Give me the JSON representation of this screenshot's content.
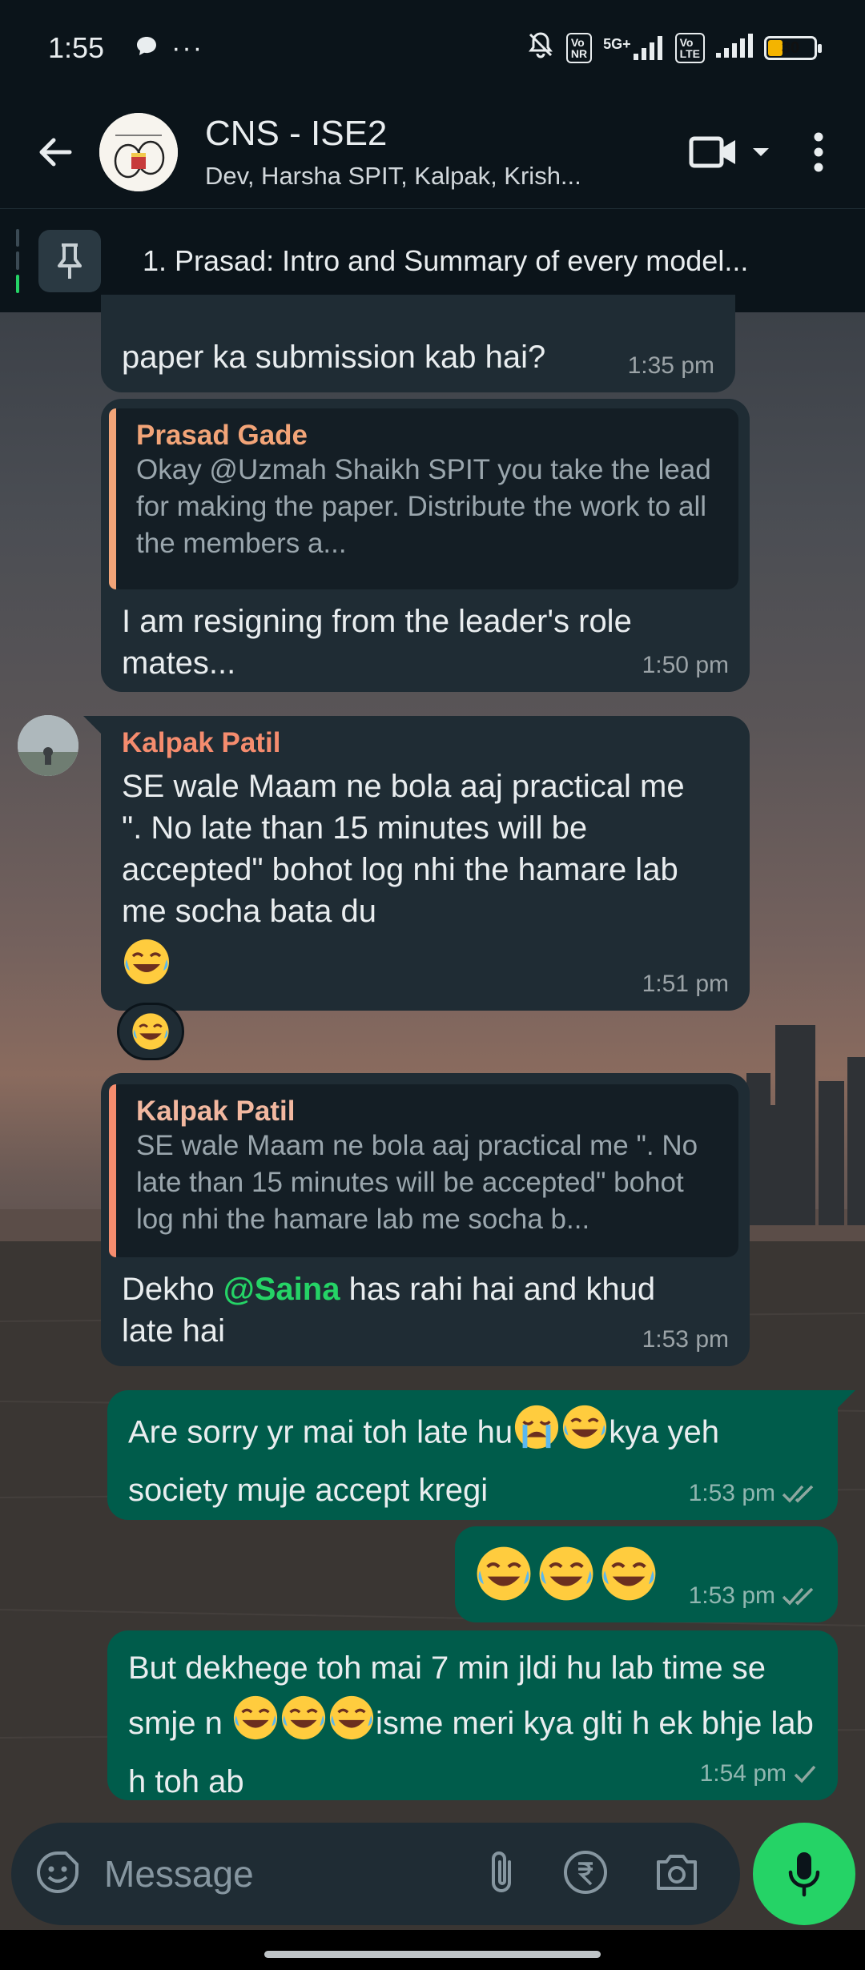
{
  "status_bar": {
    "time": "1:55",
    "network_tag": "5G+",
    "battery": "30"
  },
  "header": {
    "title": "CNS - ISE2",
    "subtitle": "Dev, Harsha SPIT, Kalpak, Krish..."
  },
  "pinned": {
    "text": "1. Prasad: Intro and Summary of every model..."
  },
  "messages": [
    {
      "text": "paper ka submission kab hai?",
      "time": "1:35 pm"
    },
    {
      "quote_name": "Prasad Gade",
      "quote_text": "Okay @Uzmah Shaikh SPIT you take the lead for making the paper. Distribute the work to all the members a...",
      "text": "I am resigning from the leader's role mates...",
      "time": "1:50 pm"
    },
    {
      "sender": "Kalpak Patil",
      "text": "SE wale Maam ne bola aaj practical me \". No late than 15 minutes will be accepted\" bohot log nhi the hamare lab me socha bata du",
      "time": "1:51 pm"
    },
    {
      "quote_name": "Kalpak Patil",
      "quote_text": "SE wale Maam ne bola aaj practical me \". No late than 15 minutes will be accepted\" bohot log nhi the hamare lab me socha b...",
      "text_before": "Dekho ",
      "mention": "@Saina",
      "text_after": " has rahi hai and khud late hai",
      "time": "1:53 pm"
    },
    {
      "text_a": "Are sorry yr mai toh late hu",
      "text_b": "kya yeh society muje accept kregi",
      "time": "1:53 pm"
    },
    {
      "time": "1:53 pm"
    },
    {
      "text_a": "But dekhege toh mai 7 min jldi hu lab time se smje n ",
      "text_b": "isme meri kya glti h ek bhje lab h toh ab",
      "time": "1:54 pm"
    }
  ],
  "composer": {
    "placeholder": "Message"
  },
  "colors": {
    "incoming_bubble": "#1f2c34",
    "outgoing_bubble": "#005c4b",
    "accent": "#25d366",
    "sender_kalpak": "#f58c6e",
    "sender_prasad": "#f2a478"
  }
}
